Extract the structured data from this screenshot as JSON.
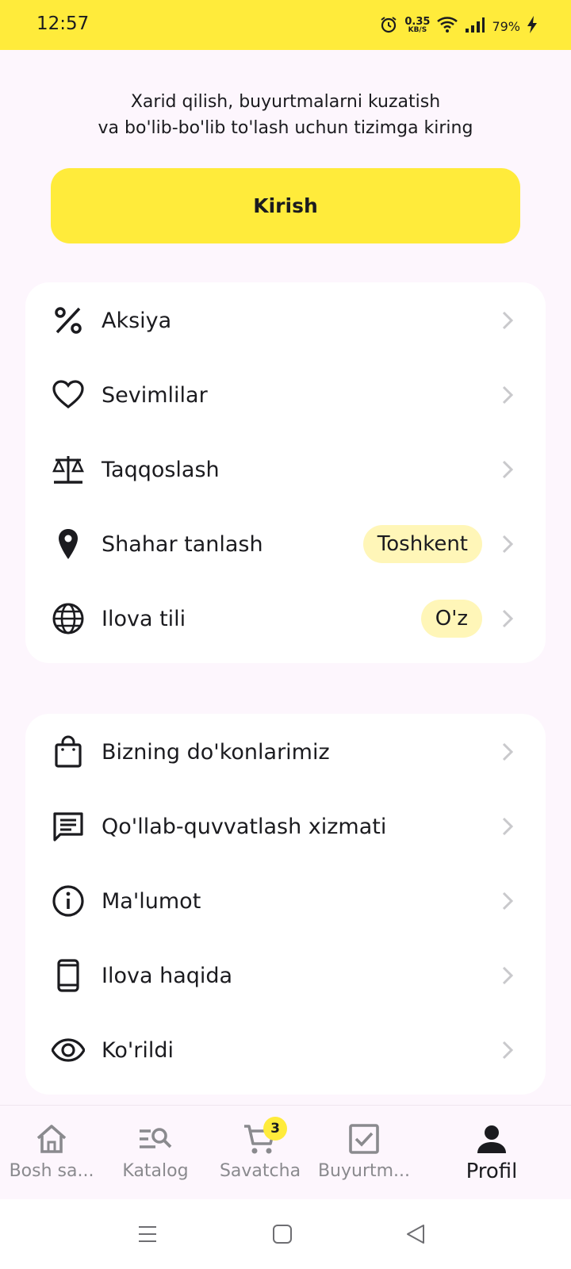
{
  "status_bar": {
    "time": "12:57",
    "speed_value": "0.35",
    "speed_unit": "KB/S",
    "battery": "79%"
  },
  "login": {
    "line1": "Xarid qilish, buyurtmalarni kuzatish",
    "line2": "va bo'lib-bo'lib to'lash uchun tizimga kiring",
    "button_label": "Kirish"
  },
  "menu_group_1": [
    {
      "label": "Aksiya",
      "icon": "percent-icon"
    },
    {
      "label": "Sevimlilar",
      "icon": "heart-icon"
    },
    {
      "label": "Taqqoslash",
      "icon": "scale-icon"
    },
    {
      "label": "Shahar tanlash",
      "icon": "location-pin-icon",
      "badge": "Toshkent"
    },
    {
      "label": "Ilova tili",
      "icon": "globe-icon",
      "badge": "O'z"
    }
  ],
  "menu_group_2": [
    {
      "label": "Bizning do'konlarimiz",
      "icon": "shopping-bag-icon"
    },
    {
      "label": "Qo'llab-quvvatlash xizmati",
      "icon": "chat-icon"
    },
    {
      "label": "Ma'lumot",
      "icon": "info-icon"
    },
    {
      "label": "Ilova haqida",
      "icon": "phone-icon"
    },
    {
      "label": "Ko'rildi",
      "icon": "eye-icon"
    }
  ],
  "bottom_nav": {
    "items": [
      {
        "label": "Bosh sa...",
        "icon": "home-icon"
      },
      {
        "label": "Katalog",
        "icon": "catalog-search-icon"
      },
      {
        "label": "Savatcha",
        "icon": "cart-icon",
        "badge": "3"
      },
      {
        "label": "Buyurtm...",
        "icon": "orders-checkbox-icon"
      },
      {
        "label": "Profil",
        "icon": "person-icon",
        "active": true
      }
    ]
  },
  "colors": {
    "accent": "#ffeb3b",
    "badge_bg": "#fff6b8",
    "background": "#fdf6fd"
  }
}
